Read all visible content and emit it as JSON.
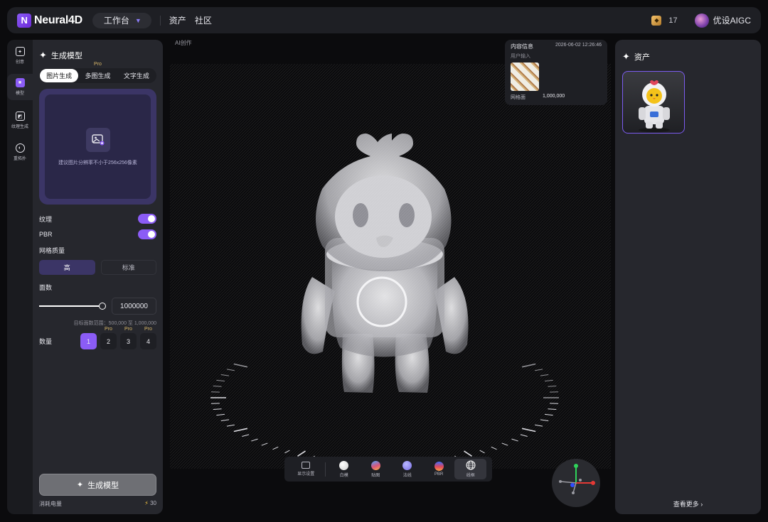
{
  "header": {
    "brand": "Neural4D",
    "workspace": "工作台",
    "nav": [
      "资产",
      "社区"
    ],
    "credits": "17",
    "username": "优设AIGC"
  },
  "rail": {
    "items": [
      {
        "label": "创意",
        "icon": "bulb-icon"
      },
      {
        "label": "模型",
        "icon": "cube-icon"
      },
      {
        "label": "纹理生成",
        "icon": "texture-icon"
      },
      {
        "label": "重拓扑",
        "icon": "retopo-icon"
      }
    ],
    "active_index": 1
  },
  "left": {
    "title": "生成模型",
    "tabs": [
      "图片生成",
      "多图生成",
      "文字生成"
    ],
    "active_tab": 0,
    "pro_label": "Pro",
    "upload_hint": "建议图片分辨率不小于256x256像素",
    "texture_label": "纹理",
    "texture_on": true,
    "pbr_label": "PBR",
    "pbr_on": true,
    "mesh_quality_label": "网格质量",
    "quality_options": [
      "高",
      "标准"
    ],
    "quality_selected": "高",
    "face_label": "面数",
    "face_value": "1000000",
    "face_slider_fraction": 1.0,
    "face_range_note": "目标面数范围：500,000 至 1,000,000",
    "count_label": "数量",
    "count_options": [
      "1",
      "2",
      "3",
      "4"
    ],
    "count_selected": "1",
    "generate_button": "生成模型",
    "cost_label": "消耗电量",
    "cost_value": "30"
  },
  "breadcrumb": "AI创作",
  "info": {
    "title": "内容信息",
    "timestamp": "2026-06-02 12:26:46",
    "user_input_label": "用户输入",
    "footer_left": "网格面",
    "footer_right": "1,000,000"
  },
  "viewer_toolbar": {
    "items": [
      {
        "label": "显示设置",
        "kind": "settings"
      },
      {
        "label": "白模",
        "kind": "ball",
        "color": "#f2f2f2"
      },
      {
        "label": "贴图",
        "kind": "ball",
        "color": "#d9557a"
      },
      {
        "label": "法线",
        "kind": "ball",
        "color": "#8f8ff2"
      },
      {
        "label": "PBR",
        "kind": "ball",
        "color": "#e0465a"
      },
      {
        "label": "线框",
        "kind": "globe"
      }
    ],
    "active_index": 5
  },
  "assets": {
    "title": "资产",
    "view_more": "查看更多"
  },
  "colors": {
    "accent": "#8b5cf6",
    "panel": "#26272d",
    "background": "#0b0b0d"
  }
}
